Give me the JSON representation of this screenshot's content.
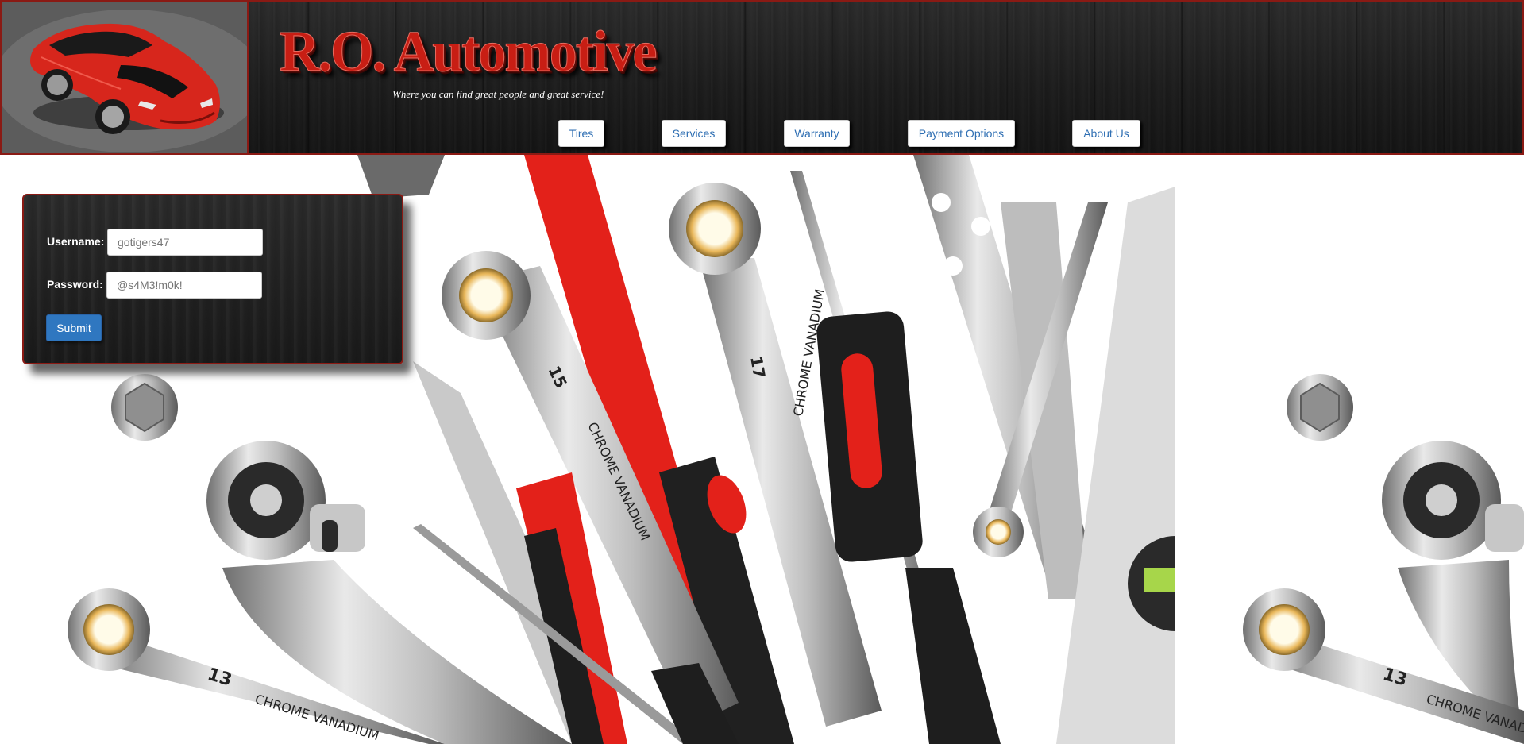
{
  "header": {
    "title": "R.O. Automotive",
    "tagline": "Where you can find great people and great service!",
    "logo_image": "red-sports-car"
  },
  "nav": {
    "items": [
      {
        "label": "Tires"
      },
      {
        "label": "Services"
      },
      {
        "label": "Warranty"
      },
      {
        "label": "Payment Options"
      },
      {
        "label": "About Us"
      }
    ]
  },
  "login": {
    "username_label": "Username:",
    "username_placeholder": "gotigers47",
    "password_label": "Password:",
    "password_placeholder": "@s4M3!m0k!",
    "submit_label": "Submit"
  },
  "background": {
    "image": "wrenches-and-tools",
    "tool_marks": [
      "15",
      "CHROME VANADIUM",
      "17",
      "CHROME VANADIUM",
      "13",
      "CHROME VANADIUM"
    ]
  },
  "colors": {
    "accent_red": "#c81e14",
    "border_red": "#8a1a14",
    "link_blue": "#2f6fb3",
    "button_blue": "#2f77c0"
  }
}
